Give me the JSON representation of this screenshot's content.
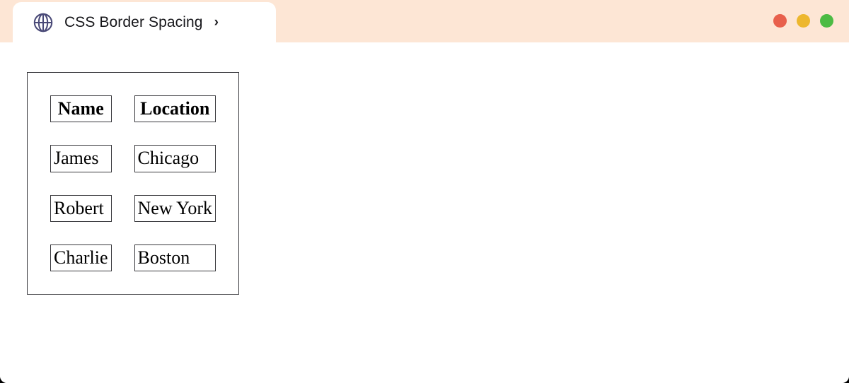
{
  "window": {
    "controls": [
      {
        "name": "close",
        "label": "Close",
        "color": "#e8604c"
      },
      {
        "name": "minimize",
        "label": "Minimize",
        "color": "#edb72e"
      },
      {
        "name": "maximize",
        "label": "Maximize",
        "color": "#4cbb44"
      }
    ],
    "chrome_background": "#fde6d5",
    "page_background": "#ffffff"
  },
  "tab": {
    "title": "CSS Border Spacing",
    "favicon": "globe-icon",
    "favicon_color": "#4a4a78",
    "chevron": "›"
  },
  "table": {
    "caption": "",
    "headers": [
      "Name",
      "Location"
    ],
    "rows": [
      [
        "James",
        "Chicago"
      ],
      [
        "Robert",
        "New York"
      ],
      [
        "Charlie",
        "Boston"
      ]
    ],
    "border_spacing": "32px",
    "border_color": "#38383c"
  }
}
